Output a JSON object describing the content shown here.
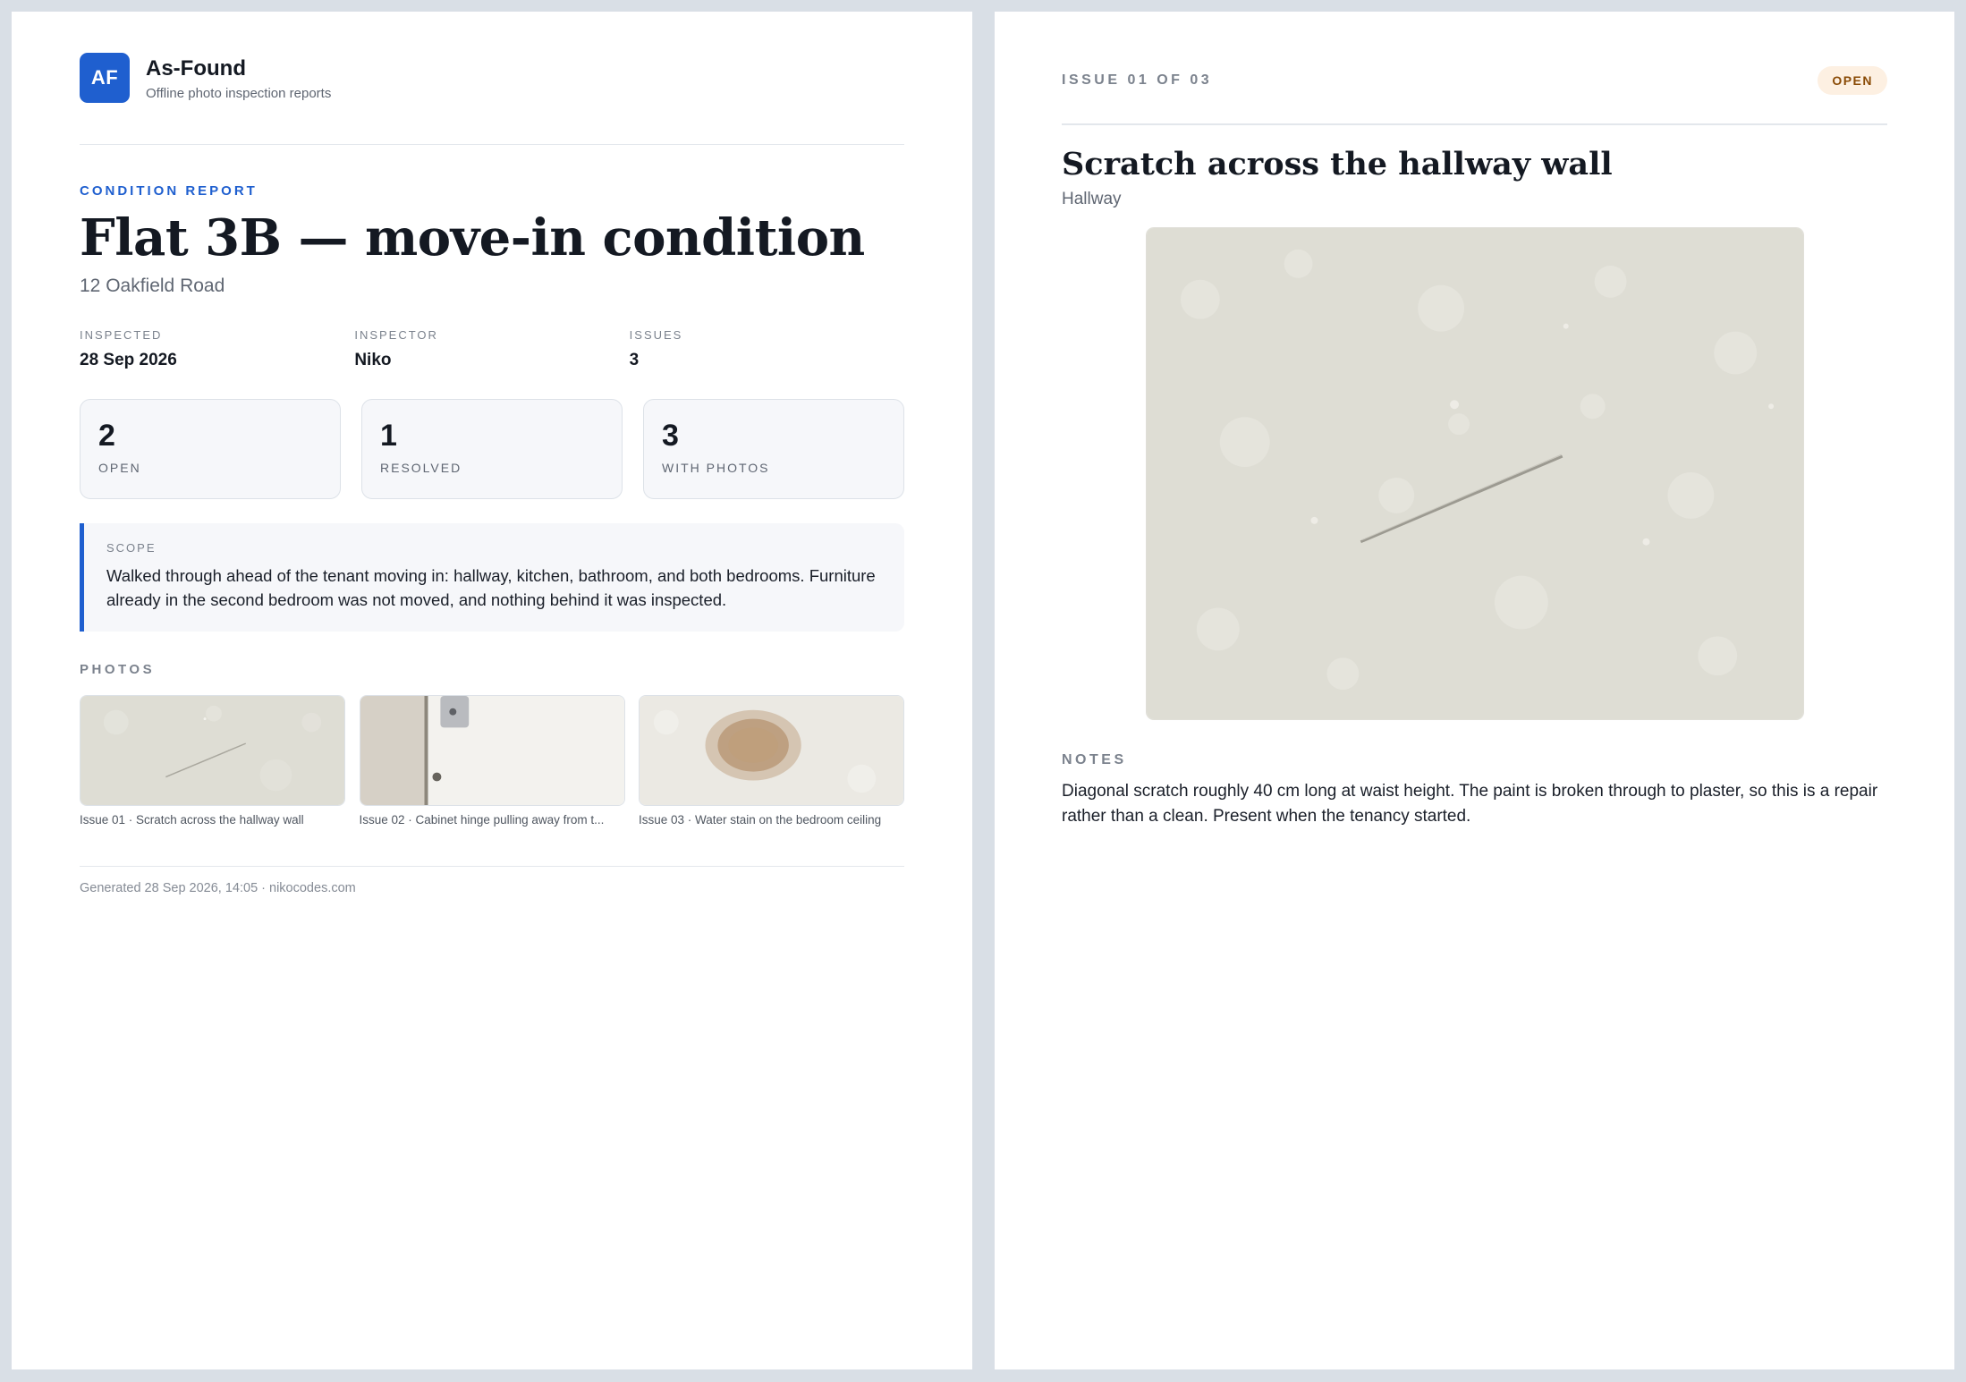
{
  "brand": {
    "logo_text": "AF",
    "name": "As-Found",
    "tagline": "Offline photo inspection reports",
    "accent_color": "#1f5fcf"
  },
  "report": {
    "eyebrow": "CONDITION REPORT",
    "title": "Flat 3B — move-in condition",
    "address": "12 Oakfield Road",
    "meta": [
      {
        "label": "INSPECTED",
        "value": "28 Sep 2026"
      },
      {
        "label": "INSPECTOR",
        "value": "Niko"
      },
      {
        "label": "ISSUES",
        "value": "3"
      }
    ],
    "stats": [
      {
        "value": "2",
        "label": "OPEN"
      },
      {
        "value": "1",
        "label": "RESOLVED"
      },
      {
        "value": "3",
        "label": "WITH PHOTOS"
      }
    ],
    "scope": {
      "label": "SCOPE",
      "text": "Walked through ahead of the tenant moving in: hallway, kitchen, bathroom, and both bedrooms. Furniture already in the second bedroom was not moved, and nothing behind it was inspected."
    },
    "photos_label": "PHOTOS",
    "photos": [
      {
        "caption": "Issue 01 · Scratch across the hallway wall",
        "icon": "wall-scratch-photo"
      },
      {
        "caption": "Issue 02 · Cabinet hinge pulling away from t...",
        "icon": "cabinet-hinge-photo"
      },
      {
        "caption": "Issue 03 · Water stain on the bedroom ceiling",
        "icon": "ceiling-stain-photo"
      }
    ],
    "footer": "Generated 28 Sep 2026, 14:05 · nikocodes.com"
  },
  "issue": {
    "counter": "ISSUE 01 OF 03",
    "status": "OPEN",
    "status_color": "#8a4b06",
    "title": "Scratch across the hallway wall",
    "location": "Hallway",
    "photo": "wall-scratch-photo",
    "notes_label": "NOTES",
    "notes": "Diagonal scratch roughly 40 cm long at waist height. The paint is broken through to plaster, so this is a repair rather than a clean. Present when the tenancy started."
  }
}
